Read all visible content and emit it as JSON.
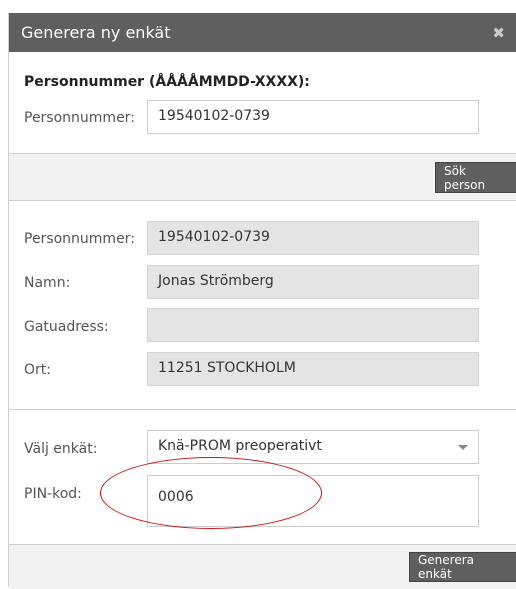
{
  "dialog": {
    "title": "Generera ny enkät",
    "close_icon": "close-icon"
  },
  "search": {
    "heading": "Personnummer (ÅÅÅÅMMDD-XXXX):",
    "label": "Personnummer:",
    "value": "19540102-0739",
    "button": "Sök person"
  },
  "person": {
    "personnummer_label": "Personnummer:",
    "personnummer_value": "19540102-0739",
    "namn_label": "Namn:",
    "namn_value": "Jonas Strömberg",
    "gatuadress_label": "Gatuadress:",
    "gatuadress_value": "",
    "ort_label": "Ort:",
    "ort_value": "11251 STOCKHOLM"
  },
  "form": {
    "enkat_label": "Välj enkät:",
    "enkat_value": "Knä-PROM preoperativt",
    "pin_label": "PIN-kod:",
    "pin_value": "0006",
    "submit": "Generera enkät"
  },
  "colors": {
    "titlebar": "#5f5f5f",
    "annotation": "#d01010"
  }
}
